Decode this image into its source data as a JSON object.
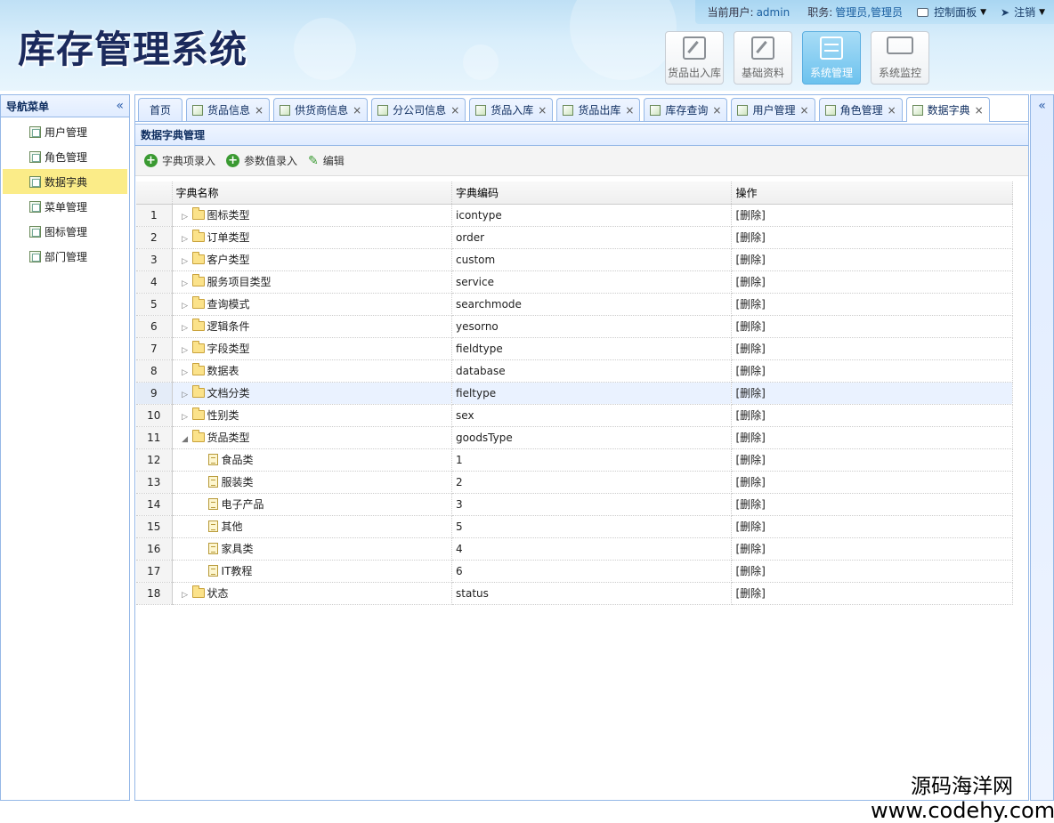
{
  "header": {
    "logo": "库存管理系统",
    "user_label": "当前用户:",
    "user_value": "admin",
    "role_label": "职务:",
    "role_value": "管理员,管理员",
    "control_panel": "控制面板",
    "logout": "注销"
  },
  "modules": [
    {
      "label": "货品出入库",
      "icon": "edit-icon"
    },
    {
      "label": "基础资料",
      "icon": "edit-icon"
    },
    {
      "label": "系统管理",
      "icon": "settings-sliders-icon"
    },
    {
      "label": "系统监控",
      "icon": "monitor-icon"
    }
  ],
  "sidebar": {
    "title": "导航菜单",
    "collapse_icon": "«",
    "items": [
      {
        "label": "用户管理"
      },
      {
        "label": "角色管理"
      },
      {
        "label": "数据字典"
      },
      {
        "label": "菜单管理"
      },
      {
        "label": "图标管理"
      },
      {
        "label": "部门管理"
      }
    ]
  },
  "rightbar": {
    "collapse_icon": "«"
  },
  "tabs": [
    {
      "label": "首页"
    },
    {
      "label": "货品信息",
      "close": "×"
    },
    {
      "label": "供货商信息",
      "close": "×"
    },
    {
      "label": "分公司信息",
      "close": "×"
    },
    {
      "label": "货品入库",
      "close": "×"
    },
    {
      "label": "货品出库",
      "close": "×"
    },
    {
      "label": "库存查询",
      "close": "×"
    },
    {
      "label": "用户管理",
      "close": "×"
    },
    {
      "label": "角色管理",
      "close": "×"
    },
    {
      "label": "数据字典",
      "close": "×"
    }
  ],
  "panel": {
    "title": "数据字典管理",
    "toolbar": {
      "add_item": "字典项录入",
      "add_value": "参数值录入",
      "edit": "编辑"
    }
  },
  "grid": {
    "columns": [
      "字典名称",
      "字典编码",
      "操作"
    ],
    "rows": [
      {
        "num": "1",
        "name": "图标类型",
        "code": "icontype",
        "op": "[删除]"
      },
      {
        "num": "2",
        "name": "订单类型",
        "code": "order",
        "op": "[删除]"
      },
      {
        "num": "3",
        "name": "客户类型",
        "code": "custom",
        "op": "[删除]"
      },
      {
        "num": "4",
        "name": "服务项目类型",
        "code": "service",
        "op": "[删除]"
      },
      {
        "num": "5",
        "name": "查询模式",
        "code": "searchmode",
        "op": "[删除]"
      },
      {
        "num": "6",
        "name": "逻辑条件",
        "code": "yesorno",
        "op": "[删除]"
      },
      {
        "num": "7",
        "name": "字段类型",
        "code": "fieldtype",
        "op": "[删除]"
      },
      {
        "num": "8",
        "name": "数据表",
        "code": "database",
        "op": "[删除]"
      },
      {
        "num": "9",
        "name": "文档分类",
        "code": "fieltype",
        "op": "[删除]"
      },
      {
        "num": "10",
        "name": "性别类",
        "code": "sex",
        "op": "[删除]"
      },
      {
        "num": "11",
        "name": "货品类型",
        "code": "goodsType",
        "op": "[删除]"
      },
      {
        "num": "12",
        "name": "食品类",
        "code": "1",
        "op": "[删除]"
      },
      {
        "num": "13",
        "name": "服装类",
        "code": "2",
        "op": "[删除]"
      },
      {
        "num": "14",
        "name": "电子产品",
        "code": "3",
        "op": "[删除]"
      },
      {
        "num": "15",
        "name": "其他",
        "code": "5",
        "op": "[删除]"
      },
      {
        "num": "16",
        "name": "家具类",
        "code": "4",
        "op": "[删除]"
      },
      {
        "num": "17",
        "name": "IT教程",
        "code": "6",
        "op": "[删除]"
      },
      {
        "num": "18",
        "name": "状态",
        "code": "status",
        "op": "[删除]"
      }
    ]
  },
  "watermark": {
    "cn": "源码海洋网",
    "en": "www.codehy.com"
  },
  "colors": {
    "accent": "#95b8e7",
    "active_nav": "#fbec88",
    "highlight_row": "#eaf2ff"
  }
}
